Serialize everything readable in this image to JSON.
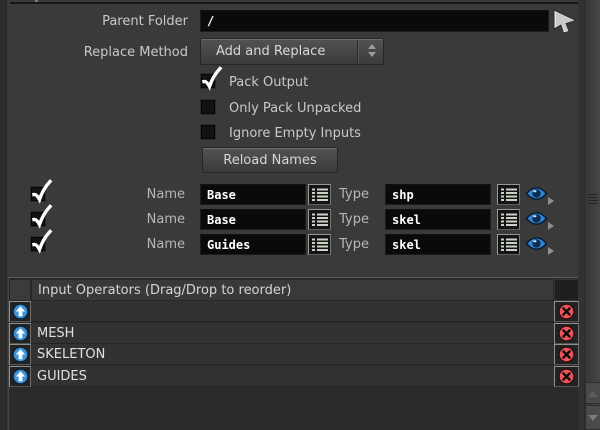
{
  "colors": {
    "background": "#3a3a3a",
    "field_bg": "#0a0a0a",
    "accent_blue": "#3d92dc",
    "accent_red": "#f2545b",
    "eye_blue": "#2f87d8"
  },
  "parent_folder": {
    "label": "Parent Folder",
    "value": "/"
  },
  "replace_method": {
    "label": "Replace Method",
    "value": "Add and Replace"
  },
  "toggles": [
    {
      "label": "Pack Output",
      "checked": true
    },
    {
      "label": "Only Pack Unpacked",
      "checked": false
    },
    {
      "label": "Ignore Empty Inputs",
      "checked": false
    }
  ],
  "reload_names_button": {
    "label": "Reload Names"
  },
  "name_type_rows": [
    {
      "checked": true,
      "name_label": "Name",
      "name_value": "Base",
      "type_label": "Type",
      "type_value": "shp"
    },
    {
      "checked": true,
      "name_label": "Name",
      "name_value": "Base",
      "type_label": "Type",
      "type_value": "skel"
    },
    {
      "checked": true,
      "name_label": "Name",
      "name_value": "Guides",
      "type_label": "Type",
      "type_value": "skel"
    }
  ],
  "input_operators": {
    "header": "Input Operators (Drag/Drop to reorder)",
    "items": [
      {
        "label": ""
      },
      {
        "label": "MESH"
      },
      {
        "label": "SKELETON"
      },
      {
        "label": "GUIDES"
      }
    ]
  }
}
